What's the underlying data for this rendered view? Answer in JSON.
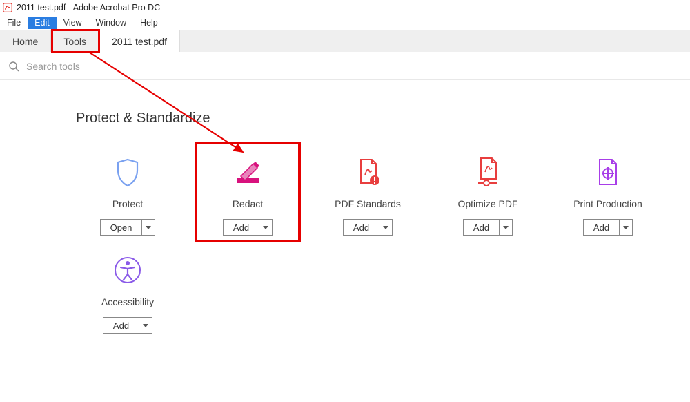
{
  "window": {
    "title": "2011 test.pdf - Adobe Acrobat Pro DC"
  },
  "menu": {
    "items": [
      "File",
      "Edit",
      "View",
      "Window",
      "Help"
    ],
    "selected_index": 1
  },
  "tabs": {
    "home": "Home",
    "tools": "Tools",
    "document": "2011 test.pdf"
  },
  "search": {
    "placeholder": "Search tools",
    "value": ""
  },
  "section": {
    "title": "Protect & Standardize"
  },
  "tools": [
    {
      "label": "Protect",
      "button": "Open",
      "icon": "shield",
      "color": "#7aa1f0"
    },
    {
      "label": "Redact",
      "button": "Add",
      "icon": "redact",
      "color": "#d8127d",
      "highlight": true
    },
    {
      "label": "PDF Standards",
      "button": "Add",
      "icon": "pdf-standards",
      "color": "#e83e3e"
    },
    {
      "label": "Optimize PDF",
      "button": "Add",
      "icon": "optimize",
      "color": "#e83e3e"
    },
    {
      "label": "Print Production",
      "button": "Add",
      "icon": "print-production",
      "color": "#a83ee8"
    },
    {
      "label": "Accessibility",
      "button": "Add",
      "icon": "accessibility",
      "color": "#8a5ae8"
    }
  ],
  "annotation": {
    "arrow_from": "tools-tab",
    "arrow_to": "redact-tool"
  }
}
